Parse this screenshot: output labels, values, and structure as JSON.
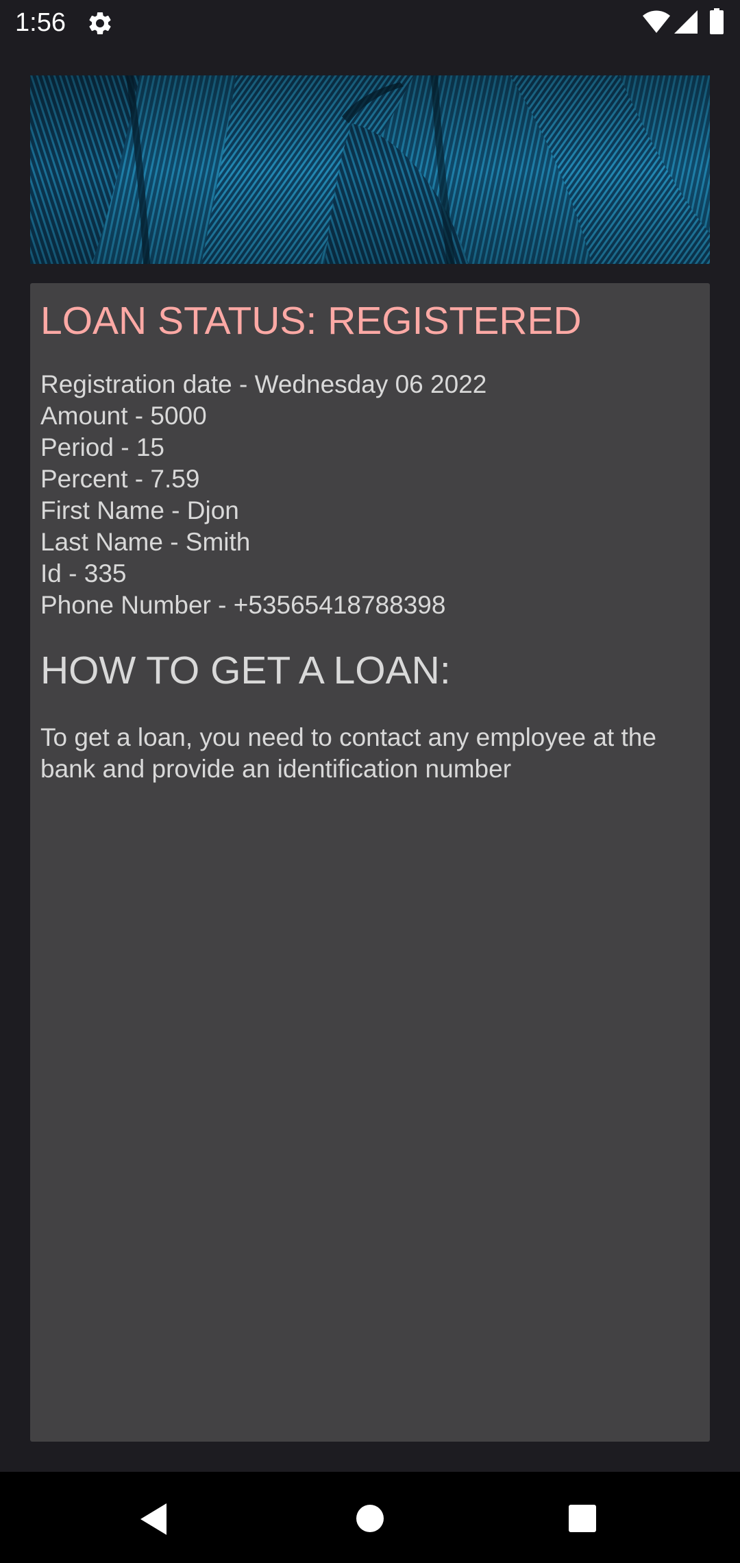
{
  "status_bar": {
    "time": "1:56",
    "icons": [
      "settings-icon",
      "wifi-icon",
      "signal-icon",
      "battery-icon"
    ]
  },
  "hero": {
    "image": "blue-feather-texture"
  },
  "loan": {
    "status_title": "LOAN STATUS: REGISTERED",
    "registration_date": "Registration date - Wednesday 06 2022",
    "amount": "Amount - 5000",
    "period": "Period - 15",
    "percent": "Percent - 7.59",
    "first_name": "First Name - Djon",
    "last_name": "Last Name - Smith",
    "id": "Id - 335",
    "phone": "Phone Number - +53565418788398"
  },
  "howto": {
    "title": "HOW TO GET A LOAN:",
    "text": "To get a loan, you need to contact any employee at the bank and provide an identification number"
  },
  "nav_bar": {
    "icons": [
      "back-icon",
      "home-icon",
      "recents-icon"
    ]
  },
  "colors": {
    "background": "#1d1c21",
    "card": "#434244",
    "status_title": "#fda9a5",
    "text": "#d9d9d9"
  }
}
